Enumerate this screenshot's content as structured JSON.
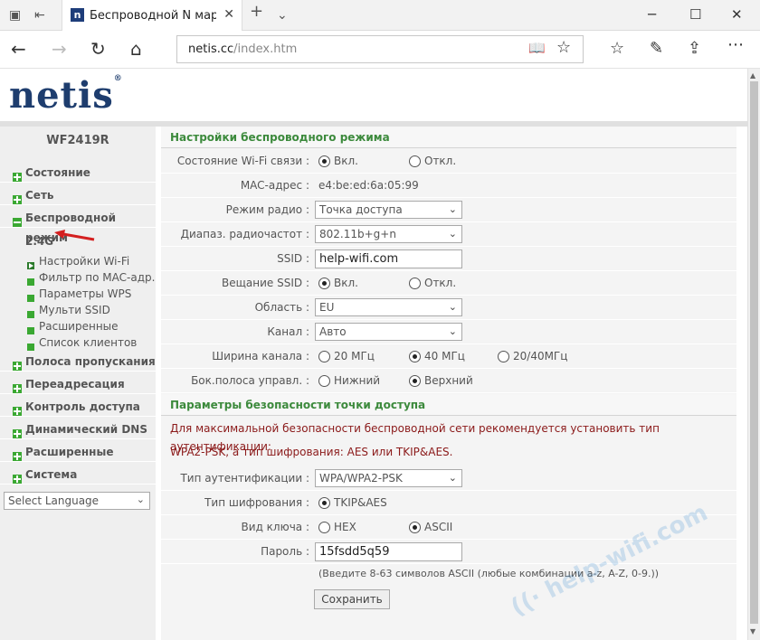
{
  "browser": {
    "tab_title": "Беспроводной N маршрут",
    "favicon_letter": "n",
    "address_host": "netis.cc",
    "address_path": "/index.htm"
  },
  "logo": {
    "text": "netis",
    "reg": "®"
  },
  "sidebar": {
    "model": "WF2419R",
    "menu_top": [
      {
        "label": "Состояние"
      },
      {
        "label": "Сеть"
      },
      {
        "label": "Беспроводной режим"
      }
    ],
    "band_label": "2.4G",
    "submenu": [
      {
        "label": "Настройки Wi-Fi"
      },
      {
        "label": "Фильтр по MAC-адр."
      },
      {
        "label": "Параметры WPS"
      },
      {
        "label": "Мульти SSID"
      },
      {
        "label": "Расширенные"
      },
      {
        "label": "Список клиентов"
      }
    ],
    "menu_bottom": [
      {
        "label": "Полоса пропускания"
      },
      {
        "label": "Переадресация"
      },
      {
        "label": "Контроль доступа"
      },
      {
        "label": "Динамический DNS"
      },
      {
        "label": "Расширенные"
      },
      {
        "label": "Система"
      }
    ],
    "language_select": "Select Language"
  },
  "wireless": {
    "section_title": "Настройки беспроводного режима",
    "wifi_state_label": "Состояние Wi-Fi связи :",
    "on": "Вкл.",
    "off": "Откл.",
    "mac_label": "MAC-адрес :",
    "mac_value": "e4:be:ed:6a:05:99",
    "radio_mode_label": "Режим радио :",
    "radio_mode_value": "Точка доступа",
    "band_label": "Диапаз. радиочастот :",
    "band_value": "802.11b+g+n",
    "ssid_label": "SSID :",
    "ssid_value": "help-wifi.com",
    "ssid_broadcast_label": "Вещание SSID :",
    "region_label": "Область :",
    "region_value": "EU",
    "channel_label": "Канал :",
    "channel_value": "Авто",
    "width_label": "Ширина канала :",
    "width_20": "20 МГц",
    "width_40": "40 МГц",
    "width_2040": "20/40МГц",
    "sideband_label": "Бок.полоса управл. :",
    "sideband_lower": "Нижний",
    "sideband_upper": "Верхний"
  },
  "security": {
    "section_title": "Параметры безопасности точки доступа",
    "warning_line1": "Для максимальной безопасности беспроводной сети рекомендуется установить тип аутентификации:",
    "warning_line2": "WPA2-PSK, а тип шифрования: AES или TKIP&AES.",
    "auth_label": "Тип аутентификации :",
    "auth_value": "WPA/WPA2-PSK",
    "enc_label": "Тип шифрования :",
    "enc_value": "TKIP&AES",
    "key_label": "Вид ключа :",
    "key_hex": "HEX",
    "key_ascii": "ASCII",
    "password_label": "Пароль :",
    "password_value": "15fsdd5q59",
    "password_hint": "(Введите 8-63 символов ASCII (любые комбинации a-z, A-Z, 0-9.))",
    "save_button": "Сохранить"
  },
  "watermark": "help-wifi.com",
  "colors": {
    "section_title": "#3c8a3c",
    "warning": "#8b1a1a",
    "logo": "#1e3d6e",
    "bullet_green": "#3aa832",
    "arrow_red": "#d42020"
  }
}
